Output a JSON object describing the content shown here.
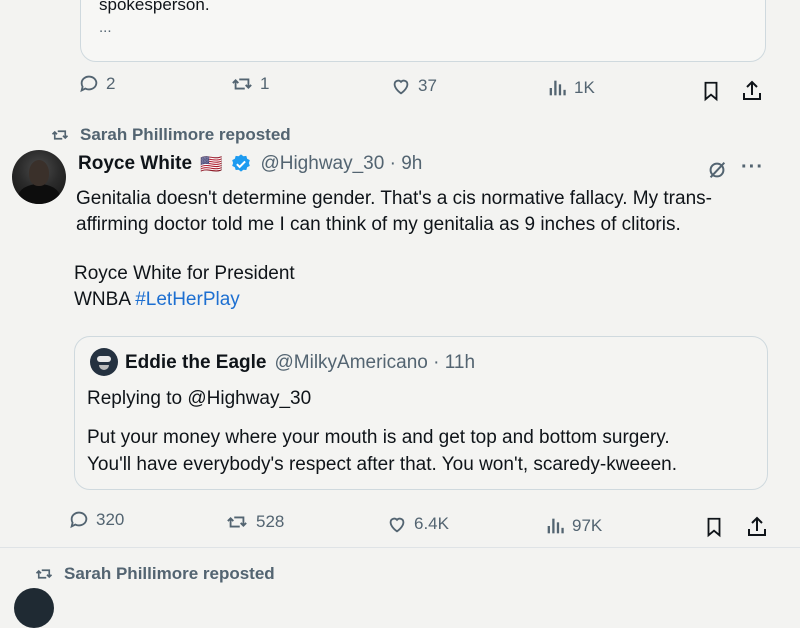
{
  "top_quote": {
    "text_line1": "spokesperson.",
    "text_line2": "..."
  },
  "top_actions": {
    "replies": "2",
    "reposts": "1",
    "likes": "37",
    "views": "1K"
  },
  "repost_header_1": {
    "text": "Sarah Phillimore reposted"
  },
  "tweet": {
    "author_name": "Royce White",
    "flag": "🇺🇸",
    "handle_time": "@Highway_30 · 9h",
    "text_line1": "Genitalia doesn't determine gender. That's a cis normative fallacy. My trans-",
    "text_line2": "affirming doctor told me I can think of my genitalia as 9 inches of clitoris.",
    "text_line3": "Royce White for President",
    "text_line4_prefix": "WNBA ",
    "hashtag": "#LetHerPlay",
    "more_label": "···"
  },
  "quoted_tweet": {
    "author_name": "Eddie the Eagle",
    "handle_time": "@MilkyAmericano · 11h",
    "replying_to": "Replying to @Highway_30",
    "text_line1": "Put your money where your mouth is and get top and bottom surgery.",
    "text_line2": "You'll have everybody's respect after that. You won't, scaredy-kweeen."
  },
  "tweet_actions": {
    "replies": "320",
    "reposts": "528",
    "likes": "6.4K",
    "views": "97K"
  },
  "repost_header_2": {
    "text": "Sarah Phillimore reposted"
  },
  "colors": {
    "link": "#1d6fd1",
    "verified": "#1d9bf0",
    "muted": "#536471"
  }
}
